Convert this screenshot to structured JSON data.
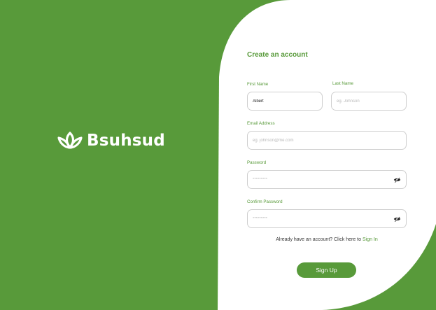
{
  "colors": {
    "brand_green": "#589a3a",
    "panel_white": "#ffffff",
    "input_border": "#cfcfcf"
  },
  "brand": {
    "name": "Bsuhsud",
    "logo_icon": "leaf-lotus-icon"
  },
  "form": {
    "title": "Create an account",
    "first_name": {
      "label": "First Name",
      "value": "Albert"
    },
    "last_name": {
      "label": "Last Name",
      "placeholder": "eg. Johnson"
    },
    "email": {
      "label": "Email Address",
      "placeholder": "eg. johnson@me.com"
    },
    "password": {
      "label": "Password",
      "placeholder": "*********",
      "toggle_icon": "eye-slash-icon"
    },
    "confirm_password": {
      "label": "Confirm Password",
      "placeholder": "*********",
      "toggle_icon": "eye-slash-icon"
    },
    "signin_prompt": "Already have an account? Click here to ",
    "signin_link": "Sign In",
    "submit_label": "Sign Up"
  }
}
